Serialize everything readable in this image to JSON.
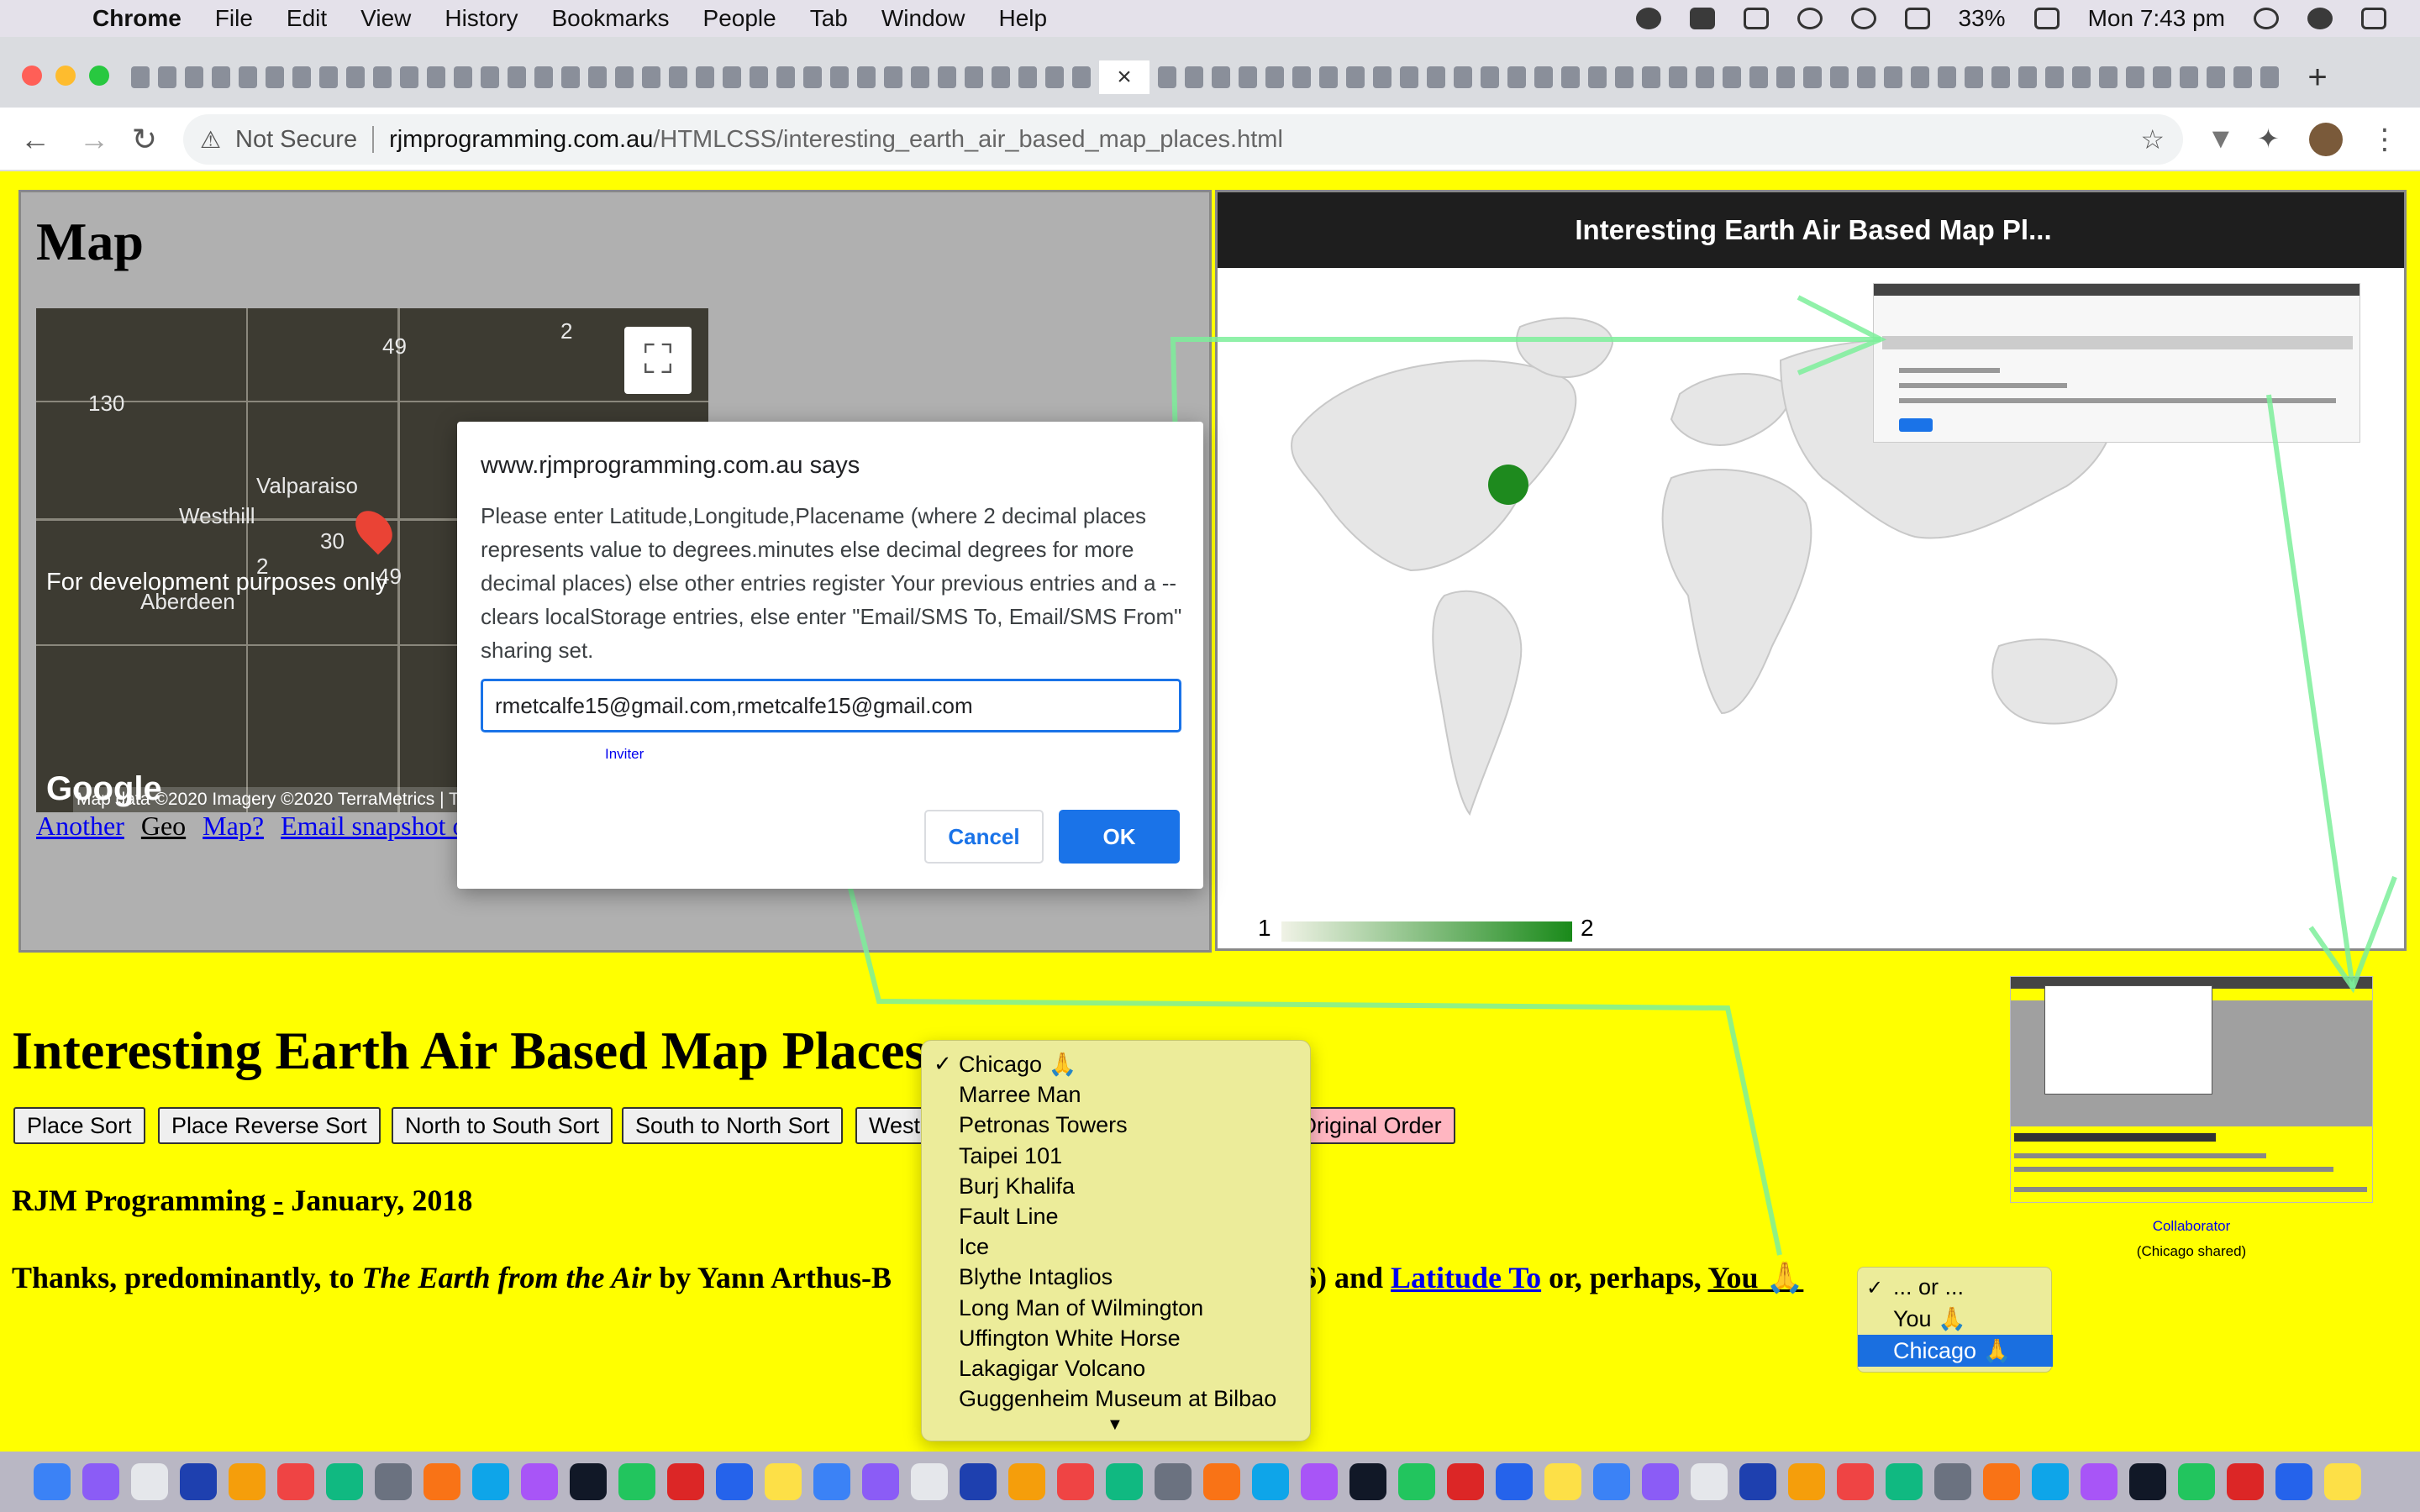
{
  "menubar": {
    "app_name": "Chrome",
    "items": [
      "File",
      "Edit",
      "View",
      "History",
      "Bookmarks",
      "People",
      "Tab",
      "Window",
      "Help"
    ],
    "battery": "33%",
    "clock": "Mon 7:43 pm"
  },
  "browser": {
    "security_label": "Not Secure",
    "url_host": "rjmprogramming.com.au",
    "url_path": "/HTMLCSS/interesting_earth_air_based_map_places.html"
  },
  "map_panel": {
    "heading": "Map",
    "towns": [
      "Valparaiso",
      "Westhill",
      "Aberdeen"
    ],
    "road_numbers": [
      "49",
      "2",
      "130",
      "30",
      "2",
      "49"
    ],
    "dev_notice": "For development purposes only",
    "google_logo": "Google",
    "attribution": "Map data ©2020 Imagery ©2020 TerraMetrics | Te",
    "links": [
      "Another",
      "Geo",
      "Map?",
      "Email snapshot of"
    ]
  },
  "slide_panel": {
    "title": "Interesting Earth Air Based Map Pl...",
    "legend_min": "1",
    "legend_max": "2"
  },
  "prompt": {
    "origin": "www.rjmprogramming.com.au says",
    "message": "Please enter Latitude,Longitude,Placename (where 2 decimal places represents value to degrees.minutes else decimal degrees for more decimal places) else other entries register Your previous entries and a -- clears localStorage entries, else enter \"Email/SMS To, Email/SMS From\" sharing set.",
    "input_value": "rmetcalfe15@gmail.com,rmetcalfe15@gmail.com",
    "inviter_link": "Inviter",
    "cancel": "Cancel",
    "ok": "OK"
  },
  "page": {
    "title": "Interesting Earth Air Based Map Places",
    "sort_buttons": [
      "Place Sort",
      "Place Reverse Sort",
      "North to South Sort",
      "South to North Sort",
      "West",
      "Original Order"
    ],
    "byline_prefix": "RJM Programming ",
    "byline_dash": "-",
    "byline_suffix": " January, 2018",
    "thanks_prefix": "Thanks, predominantly, to ",
    "thanks_book": "The Earth from the Air",
    "thanks_mid": " by Yann Arthus-B",
    "thanks_hidden_tail": "46) and ",
    "thanks_link": "Latitude To",
    "thanks_or": " or, perhaps, ",
    "thanks_you": "You 🙏"
  },
  "places_dropdown": {
    "selected": "Chicago 🙏",
    "options": [
      "Chicago 🙏",
      "Marree Man",
      "Petronas Towers",
      "Taipei 101",
      "Burj Khalifa",
      "Fault Line",
      "Ice",
      "Blythe Intaglios",
      "Long Man of Wilmington",
      "Uffington White Horse",
      "Lakagigar Volcano",
      "Guggenheim Museum at Bilbao"
    ],
    "more_indicator": "▼"
  },
  "who_dropdown": {
    "options": [
      "... or ...",
      "You 🙏",
      "Chicago 🙏"
    ],
    "selected_index": 2
  },
  "collaborator": {
    "label": "Collaborator",
    "sub": "(Chicago shared)"
  },
  "colors": {
    "page_bg": "#ffff00",
    "accent_blue": "#1a73e8",
    "arrow_green": "#7dee9a",
    "legend_high": "#1a8a1a"
  }
}
